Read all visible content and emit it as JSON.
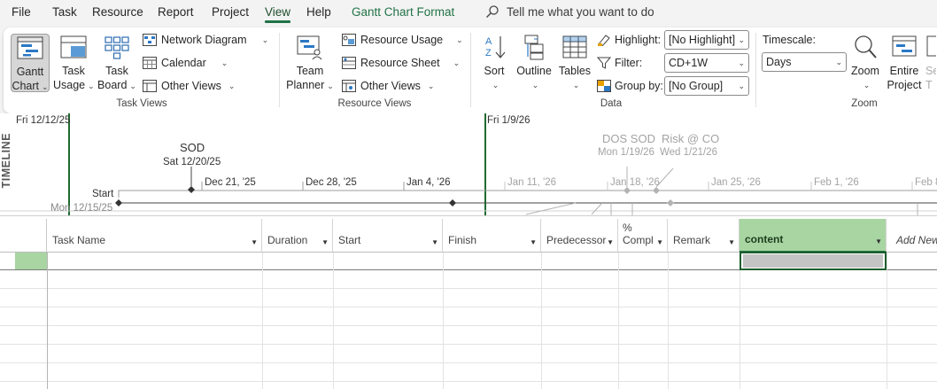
{
  "menu": {
    "file": "File",
    "task": "Task",
    "resource": "Resource",
    "report": "Report",
    "project": "Project",
    "view": "View",
    "help": "Help",
    "format": "Gantt Chart Format",
    "tell_me": "Tell me what you want to do"
  },
  "ribbon": {
    "task_views": {
      "label": "Task Views",
      "gantt_chart": [
        "Gantt",
        "Chart"
      ],
      "task_usage": [
        "Task",
        "Usage"
      ],
      "task_board": [
        "Task",
        "Board"
      ],
      "network_diagram": "Network Diagram",
      "calendar": "Calendar",
      "other_views": "Other Views"
    },
    "resource_views": {
      "label": "Resource Views",
      "team_planner": [
        "Team",
        "Planner"
      ],
      "resource_usage": "Resource Usage",
      "resource_sheet": "Resource Sheet",
      "other_views": "Other Views"
    },
    "data": {
      "label": "Data",
      "sort": "Sort",
      "outline": "Outline",
      "tables": "Tables",
      "highlight_label": "Highlight:",
      "highlight_value": "[No Highlight]",
      "filter_label": "Filter:",
      "filter_value": "CD+1W",
      "group_label": "Group by:",
      "group_value": "[No Group]"
    },
    "zoom": {
      "label": "Zoom",
      "timescale_label": "Timescale:",
      "timescale_value": "Days",
      "zoom": "Zoom",
      "entire_project": [
        "Entire",
        "Project"
      ],
      "selected_tasks": [
        "Se",
        "T"
      ]
    }
  },
  "timeline": {
    "side_label": "TIMELINE",
    "left_date": "Fri 12/12/25",
    "mid_date": "Fri 1/9/26",
    "start_label": "Start",
    "start_date": "Mon 12/15/25",
    "milestones": [
      {
        "name": "SOD",
        "date": "Sat 12/20/25"
      },
      {
        "name": "DOS SOD",
        "date": "Mon 1/19/26"
      },
      {
        "name": "Risk @ CO",
        "date": "Wed 1/21/26"
      }
    ],
    "weeks": [
      "Dec 21, '25",
      "Dec 28, '25",
      "Jan 4, '26",
      "Jan 11, '26",
      "Jan 18, '26",
      "Jan 25, '26",
      "Feb 1, '26",
      "Feb 8"
    ]
  },
  "grid": {
    "columns": [
      "Task Name",
      "Duration",
      "Start",
      "Finish",
      "Predecessors",
      "% Complete",
      "Remark",
      "content"
    ],
    "pct_top": "%",
    "pct_bottom": "Compl",
    "add_new": "Add New"
  },
  "colors": {
    "accent": "#217346",
    "selected_header": "#a8d5a2",
    "row_indicator": "#a8d5a2",
    "today_line": "#1f6b2e"
  }
}
